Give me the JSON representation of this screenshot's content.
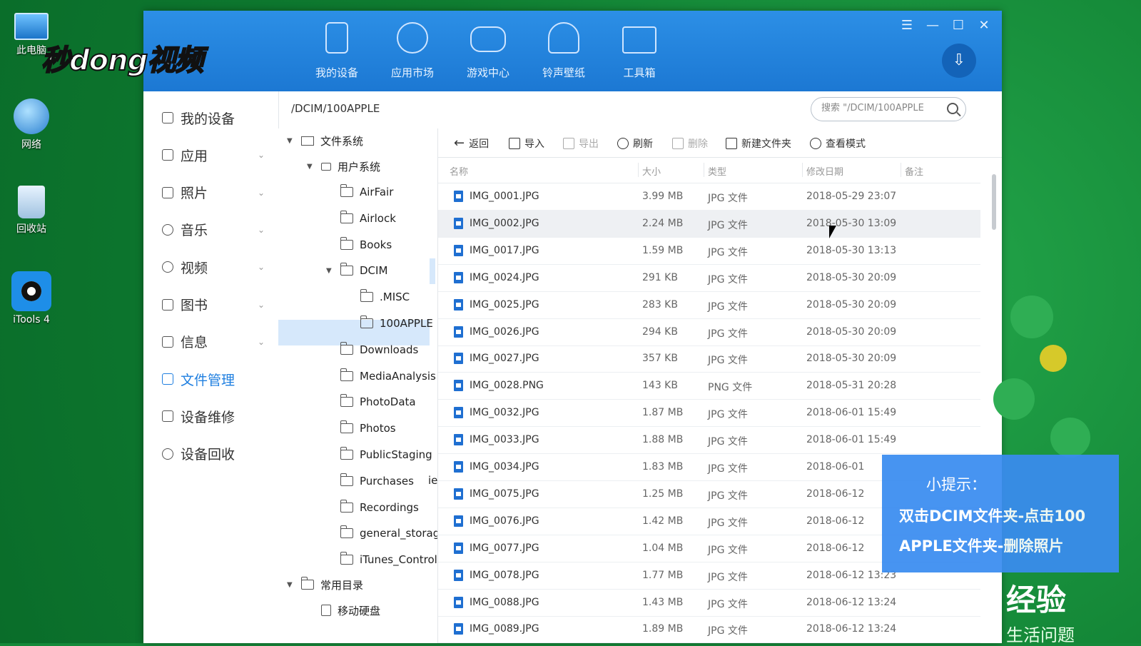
{
  "desktop": {
    "icons": [
      {
        "label": "此电脑"
      },
      {
        "label": "网络"
      },
      {
        "label": "回收站"
      },
      {
        "label": "iTools 4"
      }
    ],
    "watermark": "秒dong视频"
  },
  "app": {
    "topnav": [
      {
        "label": "我的设备",
        "icon": "phone-icon",
        "active": true
      },
      {
        "label": "应用市场",
        "icon": "apps-grid-icon",
        "active": false
      },
      {
        "label": "游戏中心",
        "icon": "gamepad-icon",
        "active": false
      },
      {
        "label": "铃声壁纸",
        "icon": "bell-icon",
        "active": false
      },
      {
        "label": "工具箱",
        "icon": "toolbox-icon",
        "active": false
      }
    ],
    "window_controls": [
      "☰",
      "—",
      "☐",
      "✕"
    ],
    "download_icon": "⇩",
    "sidebar": [
      {
        "label": "我的设备",
        "icon": "device-icon",
        "chevron": false,
        "active": false
      },
      {
        "label": "应用",
        "icon": "apps-icon",
        "chevron": true,
        "active": false
      },
      {
        "label": "照片",
        "icon": "photo-icon",
        "chevron": true,
        "active": false
      },
      {
        "label": "音乐",
        "icon": "music-icon",
        "chevron": true,
        "active": false
      },
      {
        "label": "视频",
        "icon": "video-icon",
        "chevron": true,
        "active": false
      },
      {
        "label": "图书",
        "icon": "book-icon",
        "chevron": true,
        "active": false
      },
      {
        "label": "信息",
        "icon": "message-icon",
        "chevron": true,
        "active": false
      },
      {
        "label": "文件管理",
        "icon": "folder-icon",
        "chevron": false,
        "active": true
      },
      {
        "label": "设备维修",
        "icon": "repair-icon",
        "chevron": false,
        "active": false
      },
      {
        "label": "设备回收",
        "icon": "recycle-icon",
        "chevron": false,
        "active": false
      }
    ],
    "path": "/DCIM/100APPLE",
    "search": {
      "placeholder": "搜索 \"/DCIM/100APPLE"
    },
    "tree": {
      "root": "文件系统",
      "user_system": "用户系统",
      "folders": [
        "AirFair",
        "Airlock",
        "Books",
        "DCIM",
        ".MISC",
        "100APPLE",
        "Downloads",
        "MediaAnalysis",
        "PhotoData",
        "Photos",
        "PublicStaging",
        "Purchases",
        "Recordings",
        "general_storag",
        "iTunes_Control"
      ],
      "common": "常用目录",
      "usb": "移动硬盘",
      "truncated_text": "ie"
    },
    "toolbar": [
      {
        "label": "返回",
        "icon": "back-arrow-icon",
        "disabled": false
      },
      {
        "label": "导入",
        "icon": "import-icon",
        "disabled": false
      },
      {
        "label": "导出",
        "icon": "export-icon",
        "disabled": true
      },
      {
        "label": "刷新",
        "icon": "refresh-icon",
        "disabled": false
      },
      {
        "label": "删除",
        "icon": "trash-icon",
        "disabled": true
      },
      {
        "label": "新建文件夹",
        "icon": "new-folder-icon",
        "disabled": false
      },
      {
        "label": "查看模式",
        "icon": "view-mode-icon",
        "disabled": false
      }
    ],
    "columns": {
      "name": "名称",
      "size": "大小",
      "type": "类型",
      "date": "修改日期",
      "note": "备注"
    },
    "files": [
      {
        "name": "IMG_0001.JPG",
        "size": "3.99 MB",
        "type": "JPG 文件",
        "date": "2018-05-29 23:07"
      },
      {
        "name": "IMG_0002.JPG",
        "size": "2.24 MB",
        "type": "JPG 文件",
        "date": "2018-05-30 13:09"
      },
      {
        "name": "IMG_0017.JPG",
        "size": "1.59 MB",
        "type": "JPG 文件",
        "date": "2018-05-30 13:13"
      },
      {
        "name": "IMG_0024.JPG",
        "size": "291 KB",
        "type": "JPG 文件",
        "date": "2018-05-30 20:09"
      },
      {
        "name": "IMG_0025.JPG",
        "size": "283 KB",
        "type": "JPG 文件",
        "date": "2018-05-30 20:09"
      },
      {
        "name": "IMG_0026.JPG",
        "size": "294 KB",
        "type": "JPG 文件",
        "date": "2018-05-30 20:09"
      },
      {
        "name": "IMG_0027.JPG",
        "size": "357 KB",
        "type": "JPG 文件",
        "date": "2018-05-30 20:09"
      },
      {
        "name": "IMG_0028.PNG",
        "size": "143 KB",
        "type": "PNG 文件",
        "date": "2018-05-31 20:28"
      },
      {
        "name": "IMG_0032.JPG",
        "size": "1.87 MB",
        "type": "JPG 文件",
        "date": "2018-06-01 15:49"
      },
      {
        "name": "IMG_0033.JPG",
        "size": "1.88 MB",
        "type": "JPG 文件",
        "date": "2018-06-01 15:49"
      },
      {
        "name": "IMG_0034.JPG",
        "size": "1.83 MB",
        "type": "JPG 文件",
        "date": "2018-06-01"
      },
      {
        "name": "IMG_0075.JPG",
        "size": "1.25 MB",
        "type": "JPG 文件",
        "date": "2018-06-12"
      },
      {
        "name": "IMG_0076.JPG",
        "size": "1.42 MB",
        "type": "JPG 文件",
        "date": "2018-06-12"
      },
      {
        "name": "IMG_0077.JPG",
        "size": "1.04 MB",
        "type": "JPG 文件",
        "date": "2018-06-12"
      },
      {
        "name": "IMG_0078.JPG",
        "size": "1.77 MB",
        "type": "JPG 文件",
        "date": "2018-06-12 13:23"
      },
      {
        "name": "IMG_0088.JPG",
        "size": "1.43 MB",
        "type": "JPG 文件",
        "date": "2018-06-12 13:24"
      },
      {
        "name": "IMG_0089.JPG",
        "size": "1.89 MB",
        "type": "JPG 文件",
        "date": "2018-06-12 13:24"
      }
    ]
  },
  "hint": {
    "title": "小提示：",
    "lines": [
      "双击DCIM文件夹-点击100",
      "APPLE文件夹-删除照片"
    ]
  },
  "overlay": {
    "logo": "经验",
    "sub": "生活问题"
  },
  "colors": {
    "accent": "#1f7fe0",
    "topbar": "#1c78d3",
    "hint_bg": "#3a8cf0",
    "desktop": "#16893a"
  }
}
